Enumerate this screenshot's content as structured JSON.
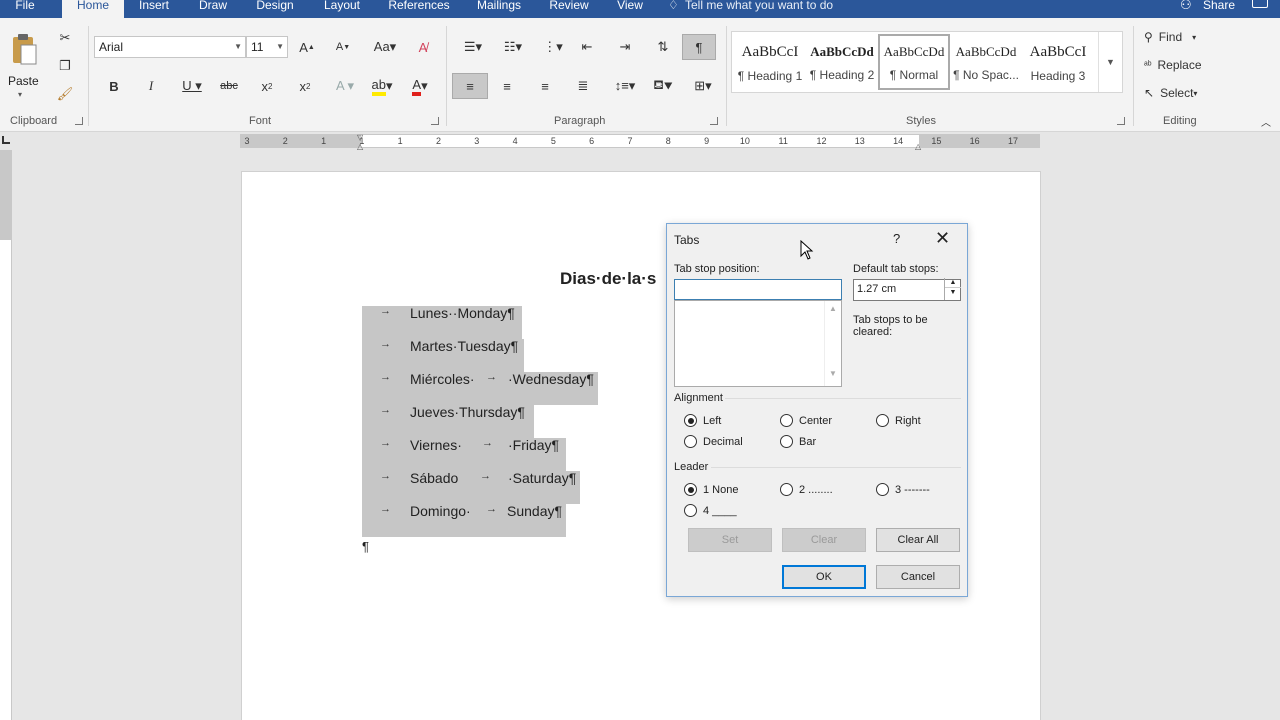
{
  "tabs": {
    "file": "File",
    "home": "Home",
    "insert": "Insert",
    "draw": "Draw",
    "design": "Design",
    "layout": "Layout",
    "references": "References",
    "mailings": "Mailings",
    "review": "Review",
    "view": "View"
  },
  "tell_me": "Tell me what you want to do",
  "share": "Share",
  "clipboard": {
    "paste": "Paste",
    "label": "Clipboard"
  },
  "font": {
    "family": "Arial",
    "size": "11",
    "label": "Font"
  },
  "paragraph": {
    "label": "Paragraph"
  },
  "styles": {
    "label": "Styles",
    "items": [
      {
        "sample": "AaBbCcI",
        "name": "¶ Heading 1"
      },
      {
        "sample": "AaBbCcDd",
        "name": "¶ Heading 2"
      },
      {
        "sample": "AaBbCcDd",
        "name": "¶ Normal"
      },
      {
        "sample": "AaBbCcDd",
        "name": "¶ No Spac..."
      },
      {
        "sample": "AaBbCcI",
        "name": "Heading 3"
      }
    ]
  },
  "editing": {
    "find": "Find",
    "replace": "Replace",
    "select": "Select",
    "label": "Editing"
  },
  "ruler": {
    "labels": [
      "3",
      "2",
      "1",
      "1",
      "1",
      "2",
      "3",
      "4",
      "5",
      "6",
      "7",
      "8",
      "9",
      "10",
      "11",
      "12",
      "13",
      "14",
      "15",
      "16",
      "17"
    ]
  },
  "document": {
    "title": "Dias·de·la·s",
    "rows": [
      {
        "spanish": "Lunes··Monday¶"
      },
      {
        "spanish": "Martes·Tuesday¶"
      },
      {
        "spanish": "Miércoles·",
        "english": "·Wednesday¶"
      },
      {
        "spanish": "Jueves·Thursday¶"
      },
      {
        "spanish": "Viernes·",
        "english": "·Friday¶"
      },
      {
        "spanish": "Sábado",
        "english": "·Saturday¶"
      },
      {
        "spanish": "Domingo·",
        "english": "Sunday¶"
      }
    ],
    "pilcrow": "¶"
  },
  "dialog": {
    "title": "Tabs",
    "help": "?",
    "tab_stop_position": "Tab stop position:",
    "default_tab_stops": "Default tab stops:",
    "default_value": "1.27 cm",
    "to_be_cleared": "Tab stops to be cleared:",
    "alignment": "Alignment",
    "align_options": [
      "Left",
      "Center",
      "Right",
      "Decimal",
      "Bar"
    ],
    "leader": "Leader",
    "leader_options": [
      "1 None",
      "2 ........",
      "3 -------",
      "4 ____"
    ],
    "set": "Set",
    "clear": "Clear",
    "clear_all": "Clear All",
    "ok": "OK",
    "cancel": "Cancel"
  }
}
